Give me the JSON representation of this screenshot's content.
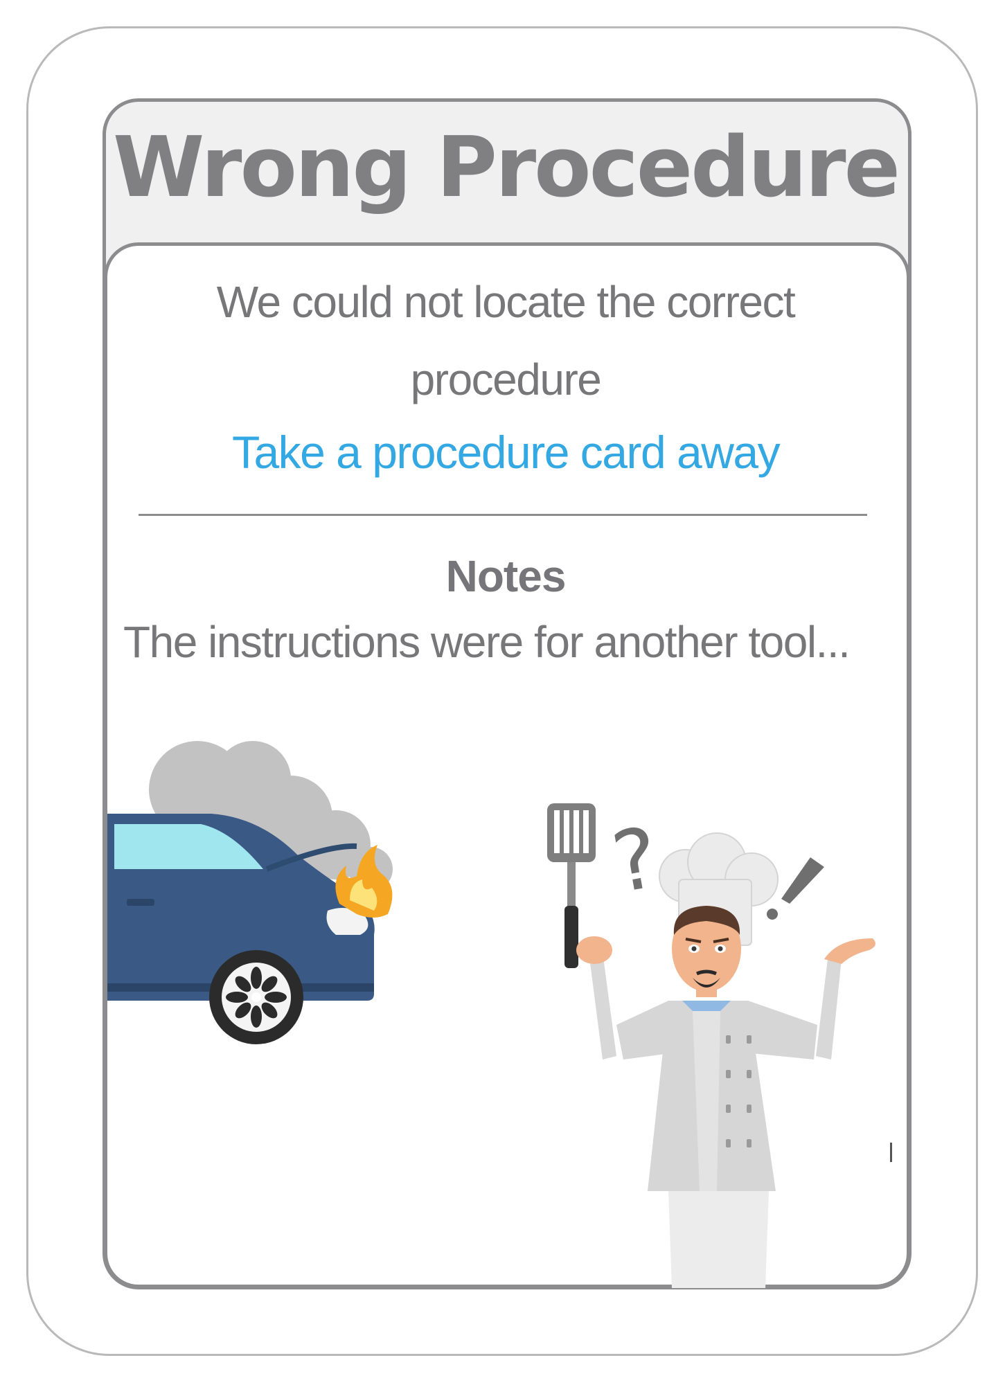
{
  "card": {
    "title": "Wrong Procedure",
    "description": "We could not locate the correct procedure",
    "action": "Take a procedure card away",
    "notes_heading": "Notes",
    "notes_text": "The instructions were for another tool..."
  },
  "colors": {
    "title": "#808083",
    "text": "#77777a",
    "accent": "#33a8e2",
    "border": "#8c8c8f",
    "header_background": "#f0f0f0",
    "car_body": "#3a5a85",
    "smoke": "#bfbfbf",
    "flame": "#f5a623"
  },
  "illustrations": {
    "left": "burning-car-icon",
    "right": "confused-chef-icon"
  }
}
